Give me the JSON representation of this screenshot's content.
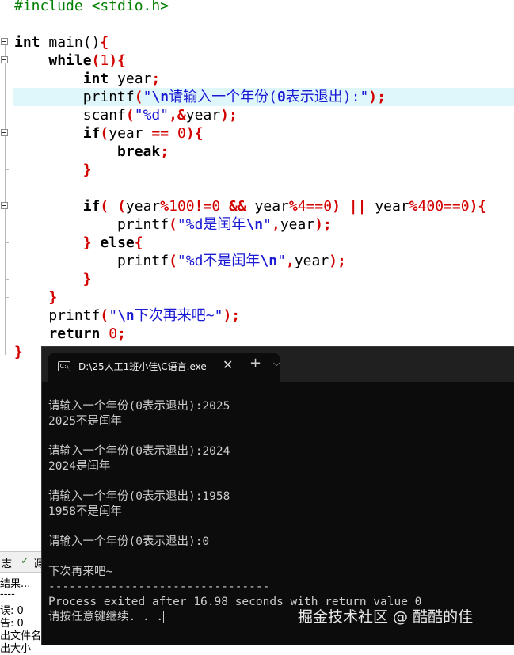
{
  "editor": {
    "code": [
      "#include <stdio.h>",
      "",
      "int main(){",
      "    while(1){",
      "        int year;",
      "        printf(\"\\n请输入一个年份(0表示退出):\");",
      "        scanf(\"%d\",&year);",
      "        if(year == 0){",
      "            break;",
      "        }",
      "",
      "        if( (year%100!=0 && year%4==0) || year%400==0){",
      "            printf(\"%d是闰年\\n\",year);",
      "        } else{",
      "            printf(\"%d不是闰年\\n\",year);",
      "        }",
      "    }",
      "    printf(\"\\n下次再来吧~\");",
      "    return 0;",
      "}"
    ]
  },
  "bottom_panel": {
    "tab_label_1": "志",
    "tab_label_2": "调",
    "lines": [
      "结果...",
      "----",
      "误: 0",
      "告: 0",
      "出文件名",
      "出大小"
    ]
  },
  "terminal": {
    "tab_title": "D:\\25人工1班小佳\\C语言.exe",
    "icon_text": "C:\\",
    "close_glyph": "✕",
    "new_tab_glyph": "+",
    "dropdown_glyph": "⌵",
    "output": [
      "请输入一个年份(0表示退出):2025",
      "2025不是闰年",
      "",
      "请输入一个年份(0表示退出):2024",
      "2024是闰年",
      "",
      "请输入一个年份(0表示退出):1958",
      "1958不是闰年",
      "",
      "请输入一个年份(0表示退出):0",
      "",
      "下次再来吧~",
      "--------------------------------",
      "Process exited after 16.98 seconds with return value 0",
      "请按任意键继续. . ."
    ]
  },
  "watermark": "掘金技术社区 @ 酷酷的佳",
  "colors": {
    "keyword": "#000000",
    "preprocessor": "#008000",
    "number": "#d30000",
    "string": "#1a1ad4",
    "current_line": "#dff7fb",
    "terminal_bg": "#0c0c0c",
    "terminal_text": "#cccccc"
  }
}
